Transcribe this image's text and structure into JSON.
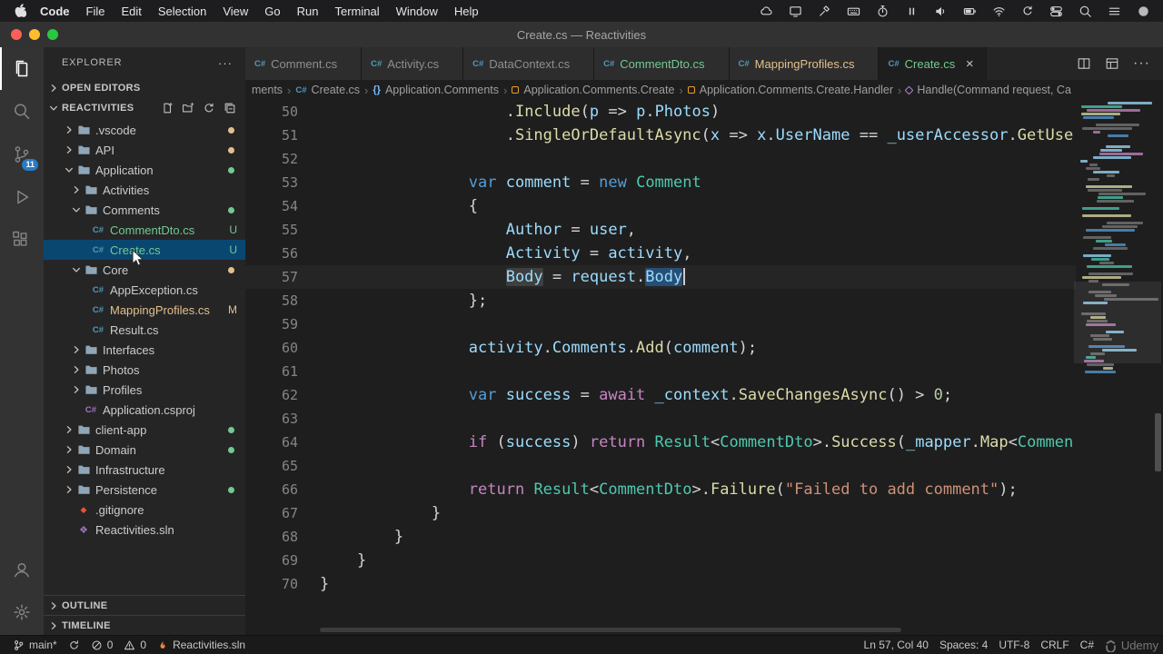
{
  "palette": {
    "accent": "#007acc",
    "git_untracked": "#73c991",
    "git_modified": "#e2c08d",
    "tree_selection": "#094771",
    "keyword": "#569cd6",
    "control": "#c586c0",
    "type": "#4ec9b0",
    "function": "#dcdcaa",
    "variable": "#9cdcfe",
    "string": "#ce9178",
    "number": "#b5cea8"
  },
  "menubar": {
    "items": [
      "Code",
      "File",
      "Edit",
      "Selection",
      "View",
      "Go",
      "Run",
      "Terminal",
      "Window",
      "Help"
    ],
    "status_icons": [
      "cloud-icon",
      "display-icon",
      "hammer-icon",
      "keyboard-icon",
      "timer-icon",
      "pause-icon",
      "speaker-icon",
      "battery-icon",
      "wifi-icon",
      "refresh-icon",
      "toggles-icon",
      "spotlight-search-icon",
      "menu-icon",
      "siri-icon"
    ]
  },
  "titlebar": {
    "title": "Create.cs — Reactivities"
  },
  "activitybar": {
    "top": [
      {
        "name": "explorer-icon",
        "active": true
      },
      {
        "name": "search-icon"
      },
      {
        "name": "source-control-icon",
        "badge": "11"
      },
      {
        "name": "run-debug-icon"
      },
      {
        "name": "extensions-icon"
      }
    ],
    "bottom": [
      {
        "name": "account-icon"
      },
      {
        "name": "settings-gear-icon"
      }
    ]
  },
  "explorer": {
    "header": "EXPLORER",
    "header_more": "···",
    "sections": {
      "open_editors": "OPEN EDITORS",
      "root": "REACTIVITIES",
      "outline": "OUTLINE",
      "timeline": "TIMELINE"
    },
    "root_actions": [
      "new-file-icon",
      "new-folder-icon",
      "refresh-icon",
      "collapse-all-icon"
    ],
    "tree": [
      {
        "label": ".vscode",
        "type": "folder",
        "level": 0,
        "chev": "r",
        "dot": "#e2c08d"
      },
      {
        "label": "API",
        "type": "folder",
        "level": 0,
        "chev": "r",
        "dot": "#e2c08d"
      },
      {
        "label": "Application",
        "type": "folder",
        "level": 0,
        "chev": "d",
        "dot": "#73c991"
      },
      {
        "label": "Activities",
        "type": "folder",
        "level": 1,
        "chev": "r"
      },
      {
        "label": "Comments",
        "type": "folder",
        "level": 1,
        "chev": "d",
        "dot": "#73c991"
      },
      {
        "label": "CommentDto.cs",
        "type": "cs",
        "level": 2,
        "badge": "U",
        "color": "#73c991"
      },
      {
        "label": "Create.cs",
        "type": "cs",
        "level": 2,
        "badge": "U",
        "color": "#73c991",
        "selected": true
      },
      {
        "label": "Core",
        "type": "folder",
        "level": 1,
        "chev": "d",
        "dot": "#e2c08d"
      },
      {
        "label": "AppException.cs",
        "type": "cs",
        "level": 2
      },
      {
        "label": "MappingProfiles.cs",
        "type": "cs",
        "level": 2,
        "badge": "M",
        "color": "#e2c08d"
      },
      {
        "label": "Result.cs",
        "type": "cs",
        "level": 2
      },
      {
        "label": "Interfaces",
        "type": "folder",
        "level": 1,
        "chev": "r"
      },
      {
        "label": "Photos",
        "type": "folder",
        "level": 1,
        "chev": "r"
      },
      {
        "label": "Profiles",
        "type": "folder",
        "level": 1,
        "chev": "r"
      },
      {
        "label": "Application.csproj",
        "type": "csproj",
        "level": 1
      },
      {
        "label": "client-app",
        "type": "folder",
        "level": 0,
        "chev": "r",
        "dot": "#73c991"
      },
      {
        "label": "Domain",
        "type": "folder",
        "level": 0,
        "chev": "r",
        "dot": "#73c991"
      },
      {
        "label": "Infrastructure",
        "type": "folder",
        "level": 0,
        "chev": "r"
      },
      {
        "label": "Persistence",
        "type": "folder",
        "level": 0,
        "chev": "r",
        "dot": "#73c991"
      },
      {
        "label": ".gitignore",
        "type": "git",
        "level": 0
      },
      {
        "label": "Reactivities.sln",
        "type": "sln",
        "level": 0
      }
    ]
  },
  "tabs": {
    "items": [
      {
        "label": "Comment.cs"
      },
      {
        "label": "Activity.cs"
      },
      {
        "label": "DataContext.cs"
      },
      {
        "label": "CommentDto.cs",
        "color": "#73c991"
      },
      {
        "label": "MappingProfiles.cs",
        "color": "#e2c08d"
      },
      {
        "label": "Create.cs",
        "active": true,
        "color": "#73c991",
        "close": "×"
      }
    ],
    "actions": [
      "split-editor-icon",
      "layout-icon",
      "more-actions-icon"
    ]
  },
  "breadcrumb": {
    "items": [
      {
        "label": "ments"
      },
      {
        "label": "Create.cs",
        "icon": "csharp"
      },
      {
        "label": "Application.Comments",
        "icon": "namespace"
      },
      {
        "label": "Application.Comments.Create",
        "icon": "class"
      },
      {
        "label": "Application.Comments.Create.Handler",
        "icon": "class"
      },
      {
        "label": "Handle(Command request, Ca",
        "icon": "method"
      }
    ]
  },
  "editor": {
    "lines": [
      {
        "n": 50,
        "ind": 20,
        "tok": [
          [
            "p",
            "."
          ],
          [
            "fn",
            "Include"
          ],
          [
            "p",
            "("
          ],
          [
            "v",
            "p"
          ],
          [
            "p",
            " => "
          ],
          [
            "v",
            "p"
          ],
          [
            "p",
            "."
          ],
          [
            "v",
            "Photos"
          ],
          [
            "p",
            ")"
          ]
        ]
      },
      {
        "n": 51,
        "ind": 20,
        "tok": [
          [
            "p",
            "."
          ],
          [
            "fn",
            "SingleOrDefaultAsync"
          ],
          [
            "p",
            "("
          ],
          [
            "v",
            "x"
          ],
          [
            "p",
            " => "
          ],
          [
            "v",
            "x"
          ],
          [
            "p",
            "."
          ],
          [
            "v",
            "UserName"
          ],
          [
            "p",
            " == "
          ],
          [
            "v",
            "_userAccessor"
          ],
          [
            "p",
            "."
          ],
          [
            "fn",
            "GetUse"
          ]
        ]
      },
      {
        "n": 52,
        "ind": 0,
        "tok": []
      },
      {
        "n": 53,
        "ind": 16,
        "tok": [
          [
            "kw",
            "var"
          ],
          [
            "p",
            " "
          ],
          [
            "v",
            "comment"
          ],
          [
            "p",
            " = "
          ],
          [
            "kw",
            "new"
          ],
          [
            "p",
            " "
          ],
          [
            "typ",
            "Comment"
          ]
        ]
      },
      {
        "n": 54,
        "ind": 16,
        "tok": [
          [
            "p",
            "{"
          ]
        ]
      },
      {
        "n": 55,
        "ind": 20,
        "tok": [
          [
            "v",
            "Author"
          ],
          [
            "p",
            " = "
          ],
          [
            "v",
            "user"
          ],
          [
            "p",
            ","
          ]
        ]
      },
      {
        "n": 56,
        "ind": 20,
        "tok": [
          [
            "v",
            "Activity"
          ],
          [
            "p",
            " = "
          ],
          [
            "v",
            "activity"
          ],
          [
            "p",
            ","
          ]
        ]
      },
      {
        "n": 57,
        "ind": 20,
        "tok": [
          [
            "v wh",
            "Body"
          ],
          [
            "p",
            " = "
          ],
          [
            "v",
            "request"
          ],
          [
            "p",
            "."
          ],
          [
            "v sel",
            "Body"
          ]
        ],
        "cursor": true,
        "current": true
      },
      {
        "n": 58,
        "ind": 16,
        "tok": [
          [
            "p",
            "};"
          ]
        ]
      },
      {
        "n": 59,
        "ind": 0,
        "tok": []
      },
      {
        "n": 60,
        "ind": 16,
        "tok": [
          [
            "v",
            "activity"
          ],
          [
            "p",
            "."
          ],
          [
            "v",
            "Comments"
          ],
          [
            "p",
            "."
          ],
          [
            "fn",
            "Add"
          ],
          [
            "p",
            "("
          ],
          [
            "v",
            "comment"
          ],
          [
            "p",
            ");"
          ]
        ]
      },
      {
        "n": 61,
        "ind": 0,
        "tok": []
      },
      {
        "n": 62,
        "ind": 16,
        "tok": [
          [
            "kw",
            "var"
          ],
          [
            "p",
            " "
          ],
          [
            "v",
            "success"
          ],
          [
            "p",
            " = "
          ],
          [
            "ctl",
            "await"
          ],
          [
            "p",
            " "
          ],
          [
            "v",
            "_context"
          ],
          [
            "p",
            "."
          ],
          [
            "fn",
            "SaveChangesAsync"
          ],
          [
            "p",
            "() > "
          ],
          [
            "num",
            "0"
          ],
          [
            "p",
            ";"
          ]
        ]
      },
      {
        "n": 63,
        "ind": 0,
        "tok": []
      },
      {
        "n": 64,
        "ind": 16,
        "tok": [
          [
            "ctl",
            "if"
          ],
          [
            "p",
            " ("
          ],
          [
            "v",
            "success"
          ],
          [
            "p",
            ") "
          ],
          [
            "ctl",
            "return"
          ],
          [
            "p",
            " "
          ],
          [
            "typ",
            "Result"
          ],
          [
            "p",
            "<"
          ],
          [
            "typ",
            "CommentDto"
          ],
          [
            "p",
            ">."
          ],
          [
            "fn",
            "Success"
          ],
          [
            "p",
            "("
          ],
          [
            "v",
            "_mapper"
          ],
          [
            "p",
            "."
          ],
          [
            "fn",
            "Map"
          ],
          [
            "p",
            "<"
          ],
          [
            "typ",
            "Commen"
          ]
        ]
      },
      {
        "n": 65,
        "ind": 0,
        "tok": []
      },
      {
        "n": 66,
        "ind": 16,
        "tok": [
          [
            "ctl",
            "return"
          ],
          [
            "p",
            " "
          ],
          [
            "typ",
            "Result"
          ],
          [
            "p",
            "<"
          ],
          [
            "typ",
            "CommentDto"
          ],
          [
            "p",
            ">."
          ],
          [
            "fn",
            "Failure"
          ],
          [
            "p",
            "("
          ],
          [
            "s",
            "\"Failed to add comment\""
          ],
          [
            "p",
            ");"
          ]
        ]
      },
      {
        "n": 67,
        "ind": 12,
        "tok": [
          [
            "p",
            "}"
          ]
        ]
      },
      {
        "n": 68,
        "ind": 8,
        "tok": [
          [
            "p",
            "}"
          ]
        ]
      },
      {
        "n": 69,
        "ind": 4,
        "tok": [
          [
            "p",
            "}"
          ]
        ]
      },
      {
        "n": 70,
        "ind": 0,
        "tok": [
          [
            "p",
            "}"
          ]
        ]
      }
    ]
  },
  "statusbar": {
    "left": [
      {
        "icon": "git-branch-icon",
        "label": "main*"
      },
      {
        "icon": "sync-icon",
        "label": ""
      },
      {
        "icon": "error-icon",
        "label": "0"
      },
      {
        "icon": "warning-icon",
        "label": "0"
      },
      {
        "icon": "flame-icon",
        "label": "Reactivities.sln"
      }
    ],
    "right": [
      {
        "label": "Ln 57, Col 40"
      },
      {
        "label": "Spaces: 4"
      },
      {
        "label": "UTF-8"
      },
      {
        "label": "CRLF"
      },
      {
        "label": "C#"
      }
    ]
  },
  "watermark": {
    "label": "Udemy"
  }
}
